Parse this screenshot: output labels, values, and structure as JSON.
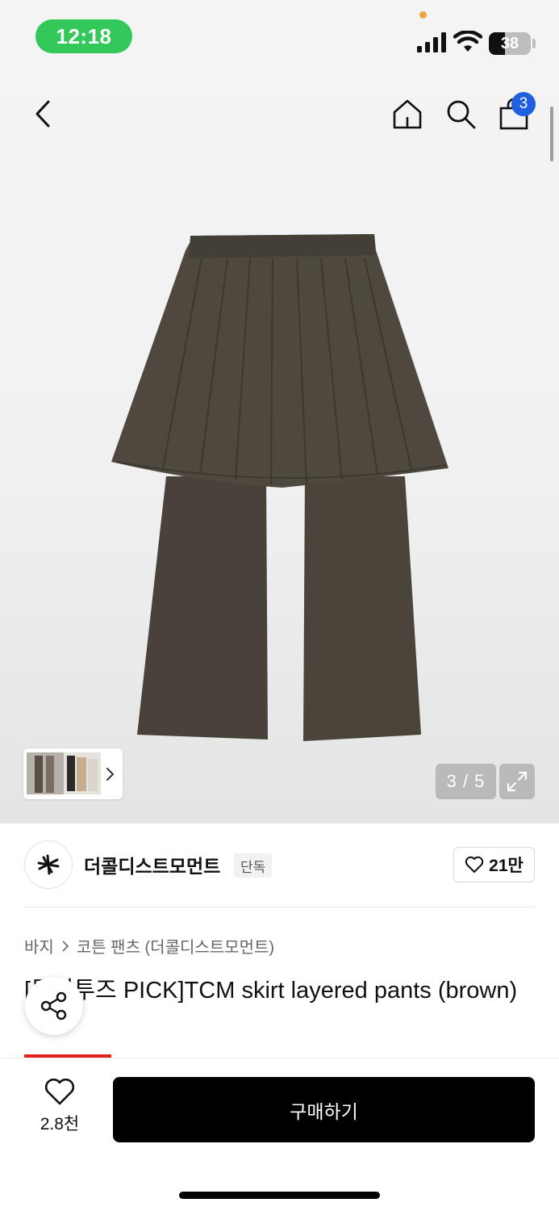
{
  "status_bar": {
    "time": "12:18",
    "battery_level": "38",
    "battery_fraction": 0.38
  },
  "nav": {
    "back_icon": "chevron-left-icon",
    "home_icon": "home-icon",
    "search_icon": "search-icon",
    "cart_icon": "shopping-bag-icon",
    "cart_count": "3"
  },
  "gallery": {
    "counter": "3 / 5",
    "expand_icon": "expand-icon",
    "thumbnail_chevron": "chevron-right-icon"
  },
  "brand": {
    "name": "더콜디스트모먼트",
    "tag": "단독",
    "likes": "21만",
    "logo_icon": "brand-logo-icon",
    "heart_icon": "heart-icon"
  },
  "breadcrumb": {
    "category": "바지",
    "subcategory": "코튼 팬츠 (더콜디스트모먼트)"
  },
  "product": {
    "title": "[뮤지투즈 PICK]TCM skirt layered pants (brown)"
  },
  "share": {
    "icon": "share-icon"
  },
  "bottom": {
    "wish_count": "2.8천",
    "buy_label": "구매하기"
  },
  "colors": {
    "accent_green": "#34c759",
    "badge_blue": "#1f5fe0",
    "sale_red": "#e0201b",
    "product_brown": "#4a4437"
  }
}
